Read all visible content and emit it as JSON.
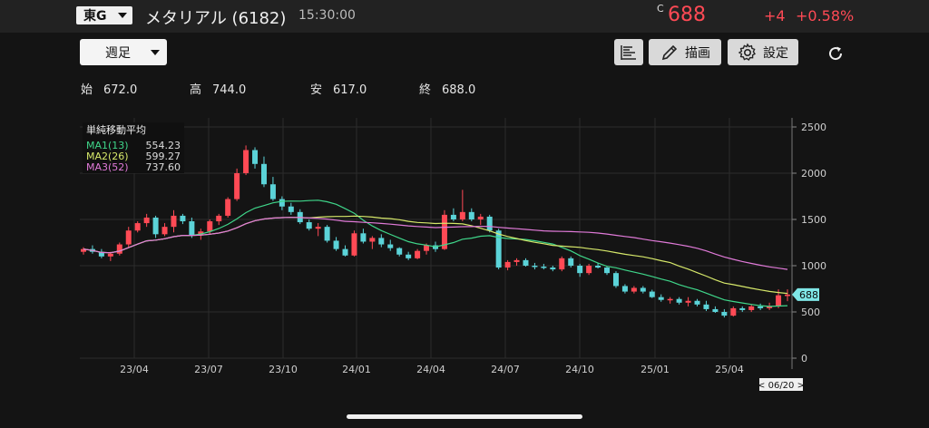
{
  "header": {
    "market": "東G",
    "name": "メタリアル (6182)",
    "time": "15:30:00",
    "price_marker": "C",
    "price": "688",
    "change": "+4",
    "change_pct": "+0.58%"
  },
  "toolbar": {
    "period": "週足",
    "draw_label": "描画",
    "settings_label": "設定"
  },
  "ohlc": {
    "open_label": "始",
    "open": "672.0",
    "high_label": "高",
    "high": "744.0",
    "low_label": "安",
    "low": "617.0",
    "close_label": "終",
    "close": "688.0"
  },
  "legend": {
    "title": "単純移動平均",
    "items": [
      {
        "name": "MA1(13)",
        "value": "554.23",
        "color": "#3fd68a"
      },
      {
        "name": "MA2(26)",
        "value": "599.27",
        "color": "#d6e86a"
      },
      {
        "name": "MA3(52)",
        "value": "737.60",
        "color": "#e07ad8"
      }
    ]
  },
  "colors": {
    "up": "#ff4a55",
    "down": "#5bd3d8",
    "price": "#ff4a55"
  },
  "icons": [
    "list-icon",
    "pencil-icon",
    "gear-icon",
    "refresh-icon"
  ],
  "chart_data": {
    "type": "candlestick",
    "ylim": [
      0,
      2500
    ],
    "y_ticks": [
      "2500",
      "2000",
      "1500",
      "1000",
      "500",
      "0"
    ],
    "x_ticks": [
      "23/04",
      "23/07",
      "23/10",
      "24/01",
      "24/04",
      "24/07",
      "24/10",
      "25/01",
      "25/04"
    ],
    "last_price_label": "688",
    "date_label": "< 06/20 >",
    "candles": [
      [
        1150,
        1200,
        1120,
        1180
      ],
      [
        1180,
        1220,
        1130,
        1150
      ],
      [
        1150,
        1180,
        1080,
        1100
      ],
      [
        1100,
        1150,
        1050,
        1130
      ],
      [
        1130,
        1250,
        1110,
        1230
      ],
      [
        1230,
        1420,
        1200,
        1380
      ],
      [
        1380,
        1480,
        1360,
        1460
      ],
      [
        1460,
        1560,
        1420,
        1520
      ],
      [
        1520,
        1540,
        1300,
        1340
      ],
      [
        1340,
        1460,
        1320,
        1420
      ],
      [
        1420,
        1600,
        1360,
        1540
      ],
      [
        1540,
        1560,
        1450,
        1480
      ],
      [
        1480,
        1520,
        1300,
        1330
      ],
      [
        1330,
        1400,
        1280,
        1370
      ],
      [
        1370,
        1500,
        1340,
        1480
      ],
      [
        1480,
        1560,
        1440,
        1540
      ],
      [
        1540,
        1740,
        1520,
        1720
      ],
      [
        1720,
        2050,
        1700,
        2000
      ],
      [
        2000,
        2300,
        1980,
        2250
      ],
      [
        2250,
        2280,
        2050,
        2100
      ],
      [
        2100,
        2180,
        1850,
        1880
      ],
      [
        1880,
        1960,
        1700,
        1720
      ],
      [
        1720,
        1750,
        1600,
        1640
      ],
      [
        1640,
        1680,
        1550,
        1580
      ],
      [
        1580,
        1610,
        1450,
        1470
      ],
      [
        1470,
        1500,
        1380,
        1400
      ],
      [
        1400,
        1460,
        1320,
        1420
      ],
      [
        1420,
        1440,
        1250,
        1270
      ],
      [
        1270,
        1310,
        1160,
        1180
      ],
      [
        1180,
        1220,
        1100,
        1110
      ],
      [
        1110,
        1380,
        1100,
        1350
      ],
      [
        1350,
        1400,
        1240,
        1260
      ],
      [
        1260,
        1320,
        1180,
        1300
      ],
      [
        1300,
        1340,
        1200,
        1230
      ],
      [
        1230,
        1280,
        1160,
        1190
      ],
      [
        1190,
        1200,
        1100,
        1120
      ],
      [
        1120,
        1150,
        1060,
        1080
      ],
      [
        1080,
        1180,
        1070,
        1160
      ],
      [
        1160,
        1240,
        1120,
        1220
      ],
      [
        1220,
        1260,
        1150,
        1180
      ],
      [
        1180,
        1600,
        1170,
        1550
      ],
      [
        1550,
        1620,
        1480,
        1500
      ],
      [
        1500,
        1820,
        1480,
        1580
      ],
      [
        1580,
        1620,
        1480,
        1500
      ],
      [
        1500,
        1560,
        1440,
        1530
      ],
      [
        1530,
        1550,
        1360,
        1380
      ],
      [
        1380,
        1400,
        960,
        980
      ],
      [
        980,
        1060,
        950,
        1040
      ],
      [
        1040,
        1080,
        1000,
        1060
      ],
      [
        1060,
        1080,
        990,
        1000
      ],
      [
        1000,
        1030,
        960,
        990
      ],
      [
        990,
        1020,
        960,
        980
      ],
      [
        980,
        1000,
        940,
        960
      ],
      [
        960,
        1100,
        940,
        1080
      ],
      [
        1080,
        1100,
        980,
        1000
      ],
      [
        1000,
        1020,
        880,
        920
      ],
      [
        920,
        1020,
        900,
        1000
      ],
      [
        1000,
        1030,
        970,
        980
      ],
      [
        980,
        990,
        900,
        920
      ],
      [
        920,
        940,
        760,
        780
      ],
      [
        780,
        800,
        700,
        720
      ],
      [
        720,
        780,
        700,
        760
      ],
      [
        760,
        780,
        700,
        720
      ],
      [
        720,
        740,
        650,
        660
      ],
      [
        660,
        690,
        610,
        630
      ],
      [
        630,
        660,
        590,
        640
      ],
      [
        640,
        660,
        580,
        600
      ],
      [
        600,
        660,
        560,
        620
      ],
      [
        620,
        640,
        560,
        580
      ],
      [
        580,
        620,
        510,
        530
      ],
      [
        530,
        560,
        490,
        500
      ],
      [
        500,
        530,
        440,
        460
      ],
      [
        460,
        560,
        450,
        540
      ],
      [
        540,
        560,
        500,
        520
      ],
      [
        520,
        580,
        500,
        560
      ],
      [
        560,
        590,
        520,
        540
      ],
      [
        540,
        600,
        520,
        560
      ],
      [
        560,
        744,
        540,
        680
      ],
      [
        672,
        744,
        617,
        688
      ]
    ],
    "ma_periods": [
      13,
      26,
      52
    ]
  }
}
